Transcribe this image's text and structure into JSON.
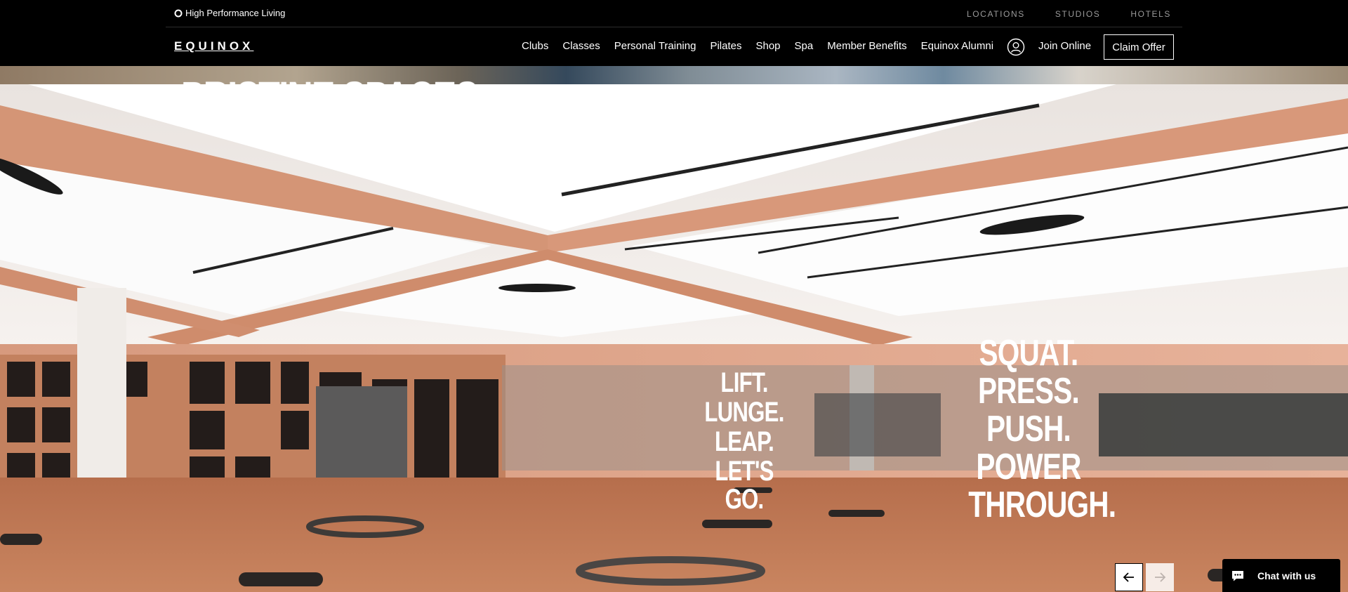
{
  "topbar": {
    "tagline": "High Performance Living",
    "links": [
      "LOCATIONS",
      "STUDIOS",
      "HOTELS"
    ]
  },
  "nav": {
    "logo": "EQUINOX",
    "links": [
      "Clubs",
      "Classes",
      "Personal Training",
      "Pilates",
      "Shop",
      "Spa",
      "Member Benefits",
      "Equinox Alumni"
    ],
    "join_label": "Join Online",
    "claim_label": "Claim Offer"
  },
  "hero": {
    "title": "PRISTINE SPACES",
    "wall_left": [
      "LIFT.",
      "LUNGE.",
      "LEAP.",
      "LET'S GO."
    ],
    "wall_right": [
      "SQUAT.",
      "PRESS.",
      "PUSH.",
      "POWER",
      "THROUGH."
    ]
  },
  "chat": {
    "label": "Chat with us"
  },
  "icons": {
    "user": "user-icon",
    "prev": "arrow-left-icon",
    "next": "arrow-right-icon",
    "chat": "chat-bubble-icon",
    "tagline": "ring-icon"
  }
}
